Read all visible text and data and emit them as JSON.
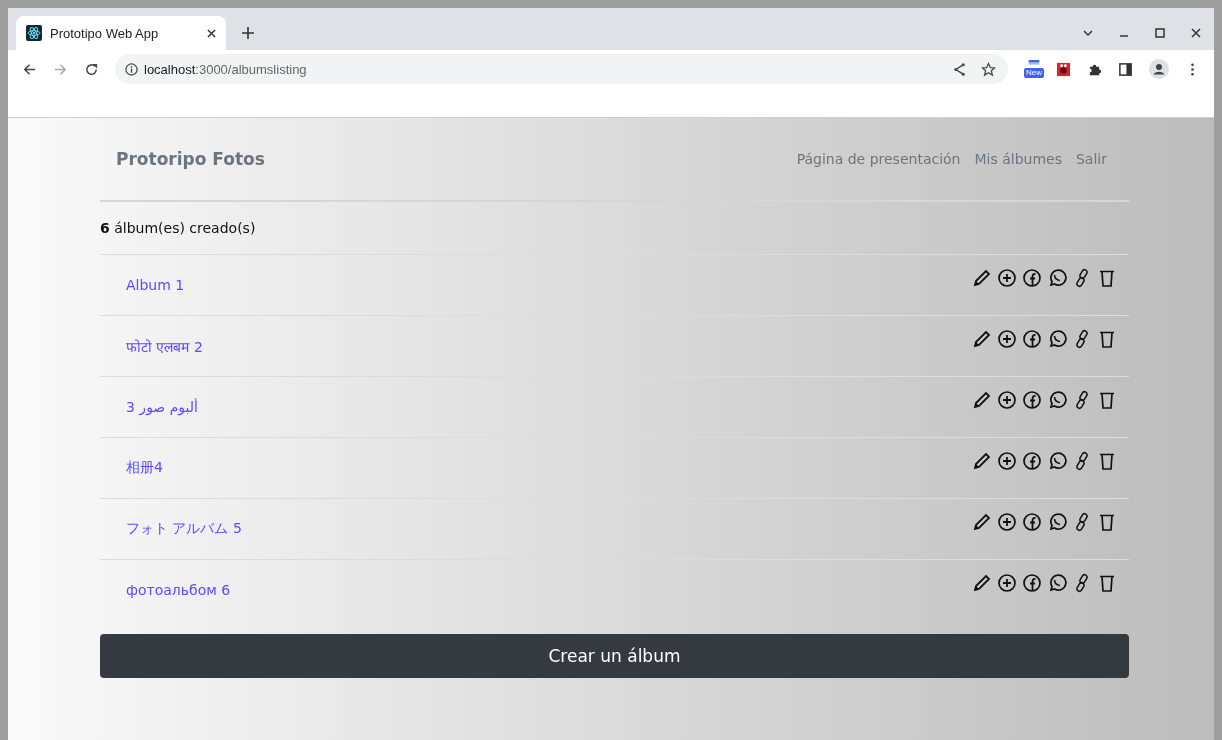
{
  "browser": {
    "tab_title": "Prototipo Web App",
    "url": {
      "host": "localhost",
      "path": ":3000/albumslisting"
    },
    "extension_badge": "New"
  },
  "navbar": {
    "brand": "Protoripo Fotos",
    "links": [
      "Página de presentación",
      "Mis álbumes",
      "Salir"
    ]
  },
  "summary": "**6** álbum(es) creado(s)",
  "albums": [
    {
      "name": "Album 1"
    },
    {
      "name": "फोटो एलबम 2"
    },
    {
      "name": "ألبوم صور 3"
    },
    {
      "name": "相册4"
    },
    {
      "name": "フォト アルバム 5"
    },
    {
      "name": "фотоальбом 6"
    }
  ],
  "create_button": "Crear un álbum"
}
